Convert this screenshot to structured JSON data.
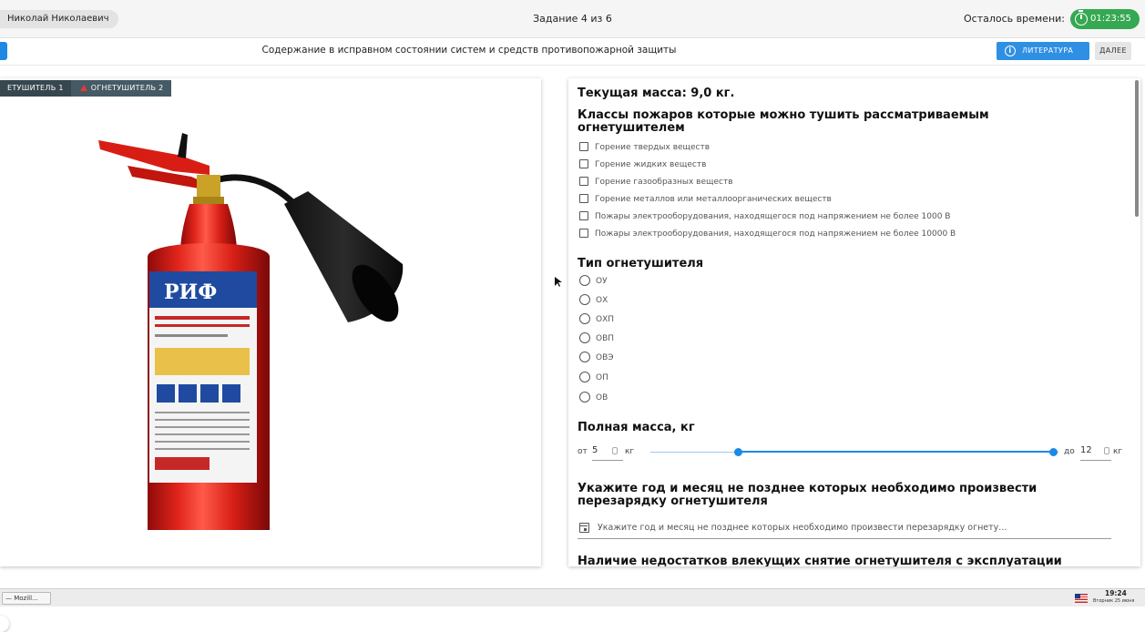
{
  "header": {
    "user_name": "Николай Николаевич",
    "task_counter": "Задание 4 из 6",
    "time_left_label": "Осталось времени:",
    "timer_value": "01:23:55",
    "timer_color": "#35a852"
  },
  "subheader": {
    "topic_title": "Содержание в исправном состоянии систем и средств противопожарной защиты",
    "literature_label": "ЛИТЕРАТУРА",
    "next_label": "ДАЛЕЕ",
    "accent": "#2f8fe3"
  },
  "image_panel": {
    "tabs": [
      {
        "label": "ЕТУШИТЕЛЬ 1",
        "active": false
      },
      {
        "label": "ОГНЕТУШИТЕЛЬ 2",
        "active": true,
        "icon": "warning-icon"
      }
    ],
    "extinguisher_brand": "РИФ"
  },
  "form": {
    "current_mass": "Текущая масса: 9,0 кг.",
    "fire_classes": {
      "heading": "Классы пожаров которые можно тушить рассматриваемым огнетушителем",
      "options": [
        "Горение твердых веществ",
        "Горение жидких веществ",
        "Горение газообразных веществ",
        "Горение металлов или металлоорганических веществ",
        "Пожары электрооборудования, находящегося под напряжением не более 1000 В",
        "Пожары электрооборудования, находящегося под напряжением не более 10000 В"
      ]
    },
    "type": {
      "heading": "Тип огнетушителя",
      "options": [
        "ОУ",
        "ОХ",
        "ОХП",
        "ОВП",
        "ОВЭ",
        "ОП",
        "ОВ"
      ]
    },
    "full_mass": {
      "heading": "Полная масса, кг",
      "from_label": "от",
      "from_value": "5",
      "to_label": "до",
      "to_value": "12",
      "unit": "кг"
    },
    "recharge": {
      "heading": "Укажите год и месяц не позднее которых необходимо произвести перезарядку огнетушителя",
      "placeholder": "Укажите год и месяц не позднее которых необходимо произвести перезарядку огнету..."
    },
    "defects_heading": "Наличие недостатков влекущих снятие огнетушителя с эксплуатации"
  },
  "taskbar": {
    "app_label": "— Mozill...",
    "time": "19:24",
    "date": "Вторник 25 июня"
  }
}
